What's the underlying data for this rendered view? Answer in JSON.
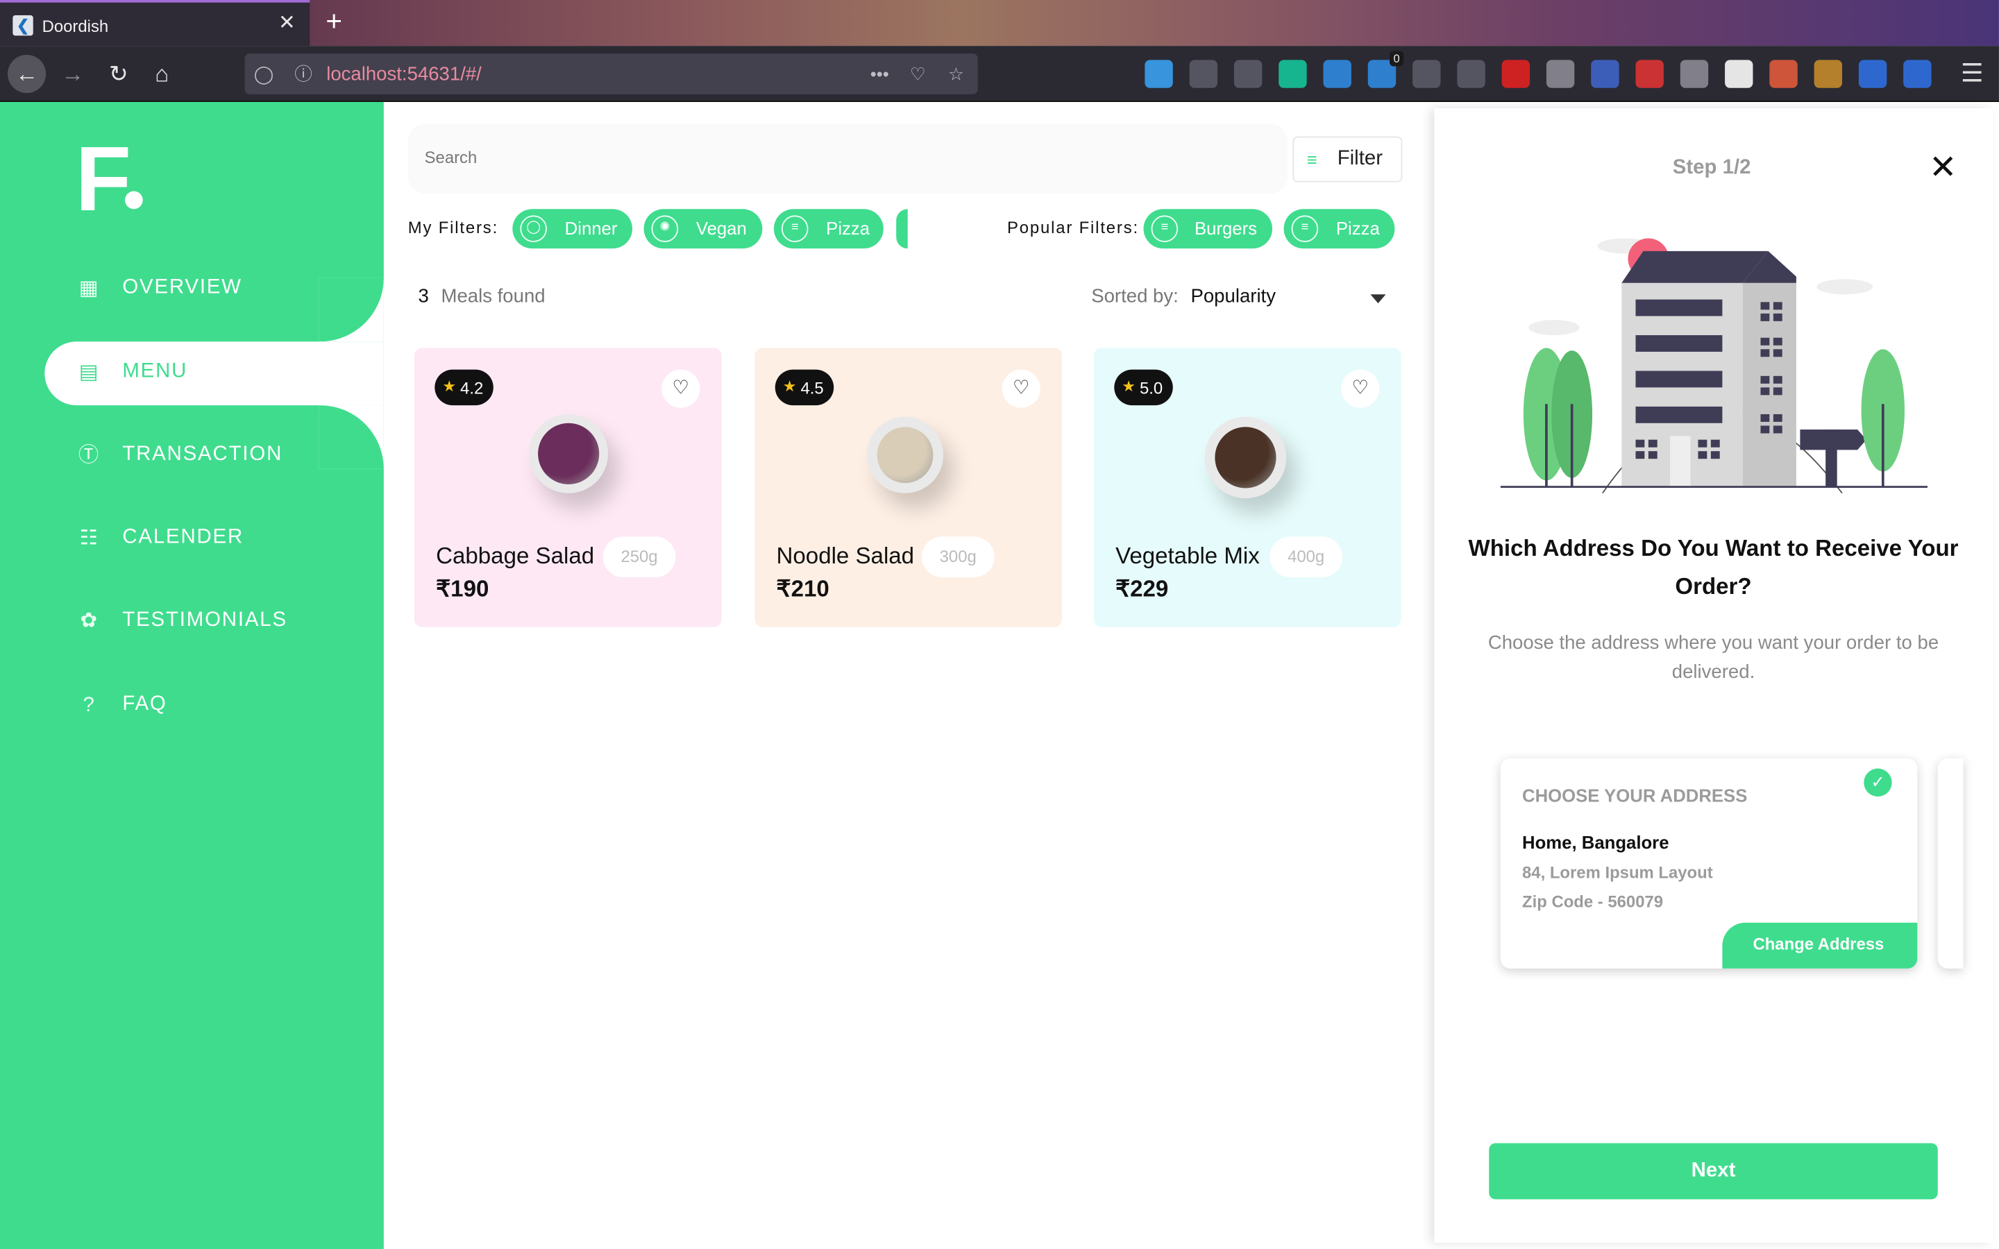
{
  "browser": {
    "tab_title": "Doordish",
    "tab_favicon": "flutter-icon",
    "url": "localhost:54631/#/",
    "url_dots": "•••",
    "extensions": [
      {
        "icon": "download-icon",
        "color": "#3aa0f0"
      },
      {
        "icon": "library-icon",
        "color": "#5a5966"
      },
      {
        "icon": "sidebar-toggle-icon",
        "color": "#5a5966"
      },
      {
        "icon": "grammarly-icon",
        "color": "#15c39a"
      },
      {
        "icon": "diamond-icon",
        "color": "#2f8ae0"
      },
      {
        "icon": "badge-extension-icon",
        "color": "#2f8ae0",
        "badge": "0"
      },
      {
        "icon": "react-devtools-icon",
        "color": "#5a5966"
      },
      {
        "icon": "eyedropper-icon",
        "color": "#5a5966"
      },
      {
        "icon": "redux-icon",
        "color": "#e02020"
      },
      {
        "icon": "profile-icon",
        "color": "#8b8a94"
      },
      {
        "icon": "mask-icon",
        "color": "#3f64c7"
      },
      {
        "icon": "camera-icon",
        "color": "#d33"
      },
      {
        "icon": "proxy-icon",
        "color": "#8b8a94"
      },
      {
        "icon": "t-icon",
        "color": "#fafafa"
      },
      {
        "icon": "gift-icon",
        "color": "#e05a3a"
      },
      {
        "icon": "cookie-icon",
        "color": "#c38a2a"
      },
      {
        "icon": "chart-icon",
        "color": "#2f6fe0"
      },
      {
        "icon": "r-icon",
        "color": "#2f6fe0"
      }
    ]
  },
  "sidebar": {
    "logo": "F",
    "items": [
      {
        "label": "OVERVIEW",
        "icon": "overview-icon"
      },
      {
        "label": "MENU",
        "icon": "menu-doc-icon",
        "active": true
      },
      {
        "label": "TRANSACTION",
        "icon": "dollar-icon"
      },
      {
        "label": "CALENDER",
        "icon": "calendar-icon"
      },
      {
        "label": "TESTIMONIALS",
        "icon": "testimonial-icon"
      },
      {
        "label": "FAQ",
        "icon": "help-icon"
      }
    ]
  },
  "main": {
    "search": {
      "placeholder": "Search"
    },
    "filter_button": "Filter",
    "my_filters_label": "My Filters:",
    "my_filters": [
      "Dinner",
      "Vegan",
      "Pizza"
    ],
    "popular_filters_label": "Popular Filters:",
    "popular_filters": [
      "Burgers",
      "Pizza"
    ],
    "meals_count": "3",
    "meals_label": "Meals found",
    "sorted_label": "Sorted by:",
    "sorted_value": "Popularity",
    "cards": [
      {
        "name": "Cabbage Salad",
        "weight": "250g",
        "price": "₹190",
        "rating": "4.2",
        "bg": "#fde8f4",
        "food": "#6b2d5c"
      },
      {
        "name": "Noodle Salad",
        "weight": "300g",
        "price": "₹210",
        "rating": "4.5",
        "bg": "#fdefe4",
        "food": "#d9cdb8"
      },
      {
        "name": "Vegetable Mix",
        "weight": "400g",
        "price": "₹229",
        "rating": "5.0",
        "bg": "#e6fbfb",
        "food": "#4a3326"
      }
    ]
  },
  "panel": {
    "step": "Step 1/2",
    "title": "Which Address Do You Want to Receive Your Order?",
    "subtitle": "Choose the address where you want your order to be delivered.",
    "address": {
      "heading": "CHOOSE YOUR ADDRESS",
      "name": "Home, Bangalore",
      "line": "84, Lorem Ipsum Layout",
      "zip": "Zip Code - 560079",
      "change_label": "Change Address"
    },
    "next_label": "Next"
  },
  "colors": {
    "accent": "#3fdc8e",
    "sidebar": "#3fdc8e"
  }
}
